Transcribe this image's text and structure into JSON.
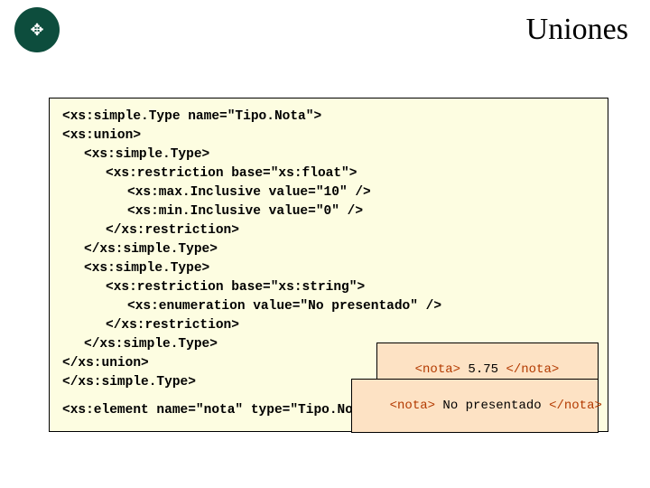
{
  "title": "Uniones",
  "code": {
    "l1": "<xs:simple.Type name=\"Tipo.Nota\">",
    "l2": "<xs:union>",
    "l3": "<xs:simple.Type>",
    "l4": "<xs:restriction base=\"xs:float\">",
    "l5": "<xs:max.Inclusive value=\"10\" />",
    "l6": "<xs:min.Inclusive value=\"0\" />",
    "l7": "</xs:restriction>",
    "l8": "</xs:simple.Type>",
    "l9": "<xs:simple.Type>",
    "l10": "<xs:restriction base=\"xs:string\">",
    "l11": "<xs:enumeration value=\"No presentado\" />",
    "l12": "</xs:restriction>",
    "l13": "</xs:simple.Type>",
    "l14": "</xs:union>",
    "l15": "</xs:simple.Type>",
    "l16": "<xs:element name=\"nota\" type=\"Tipo.Nota\" />"
  },
  "ex1": {
    "open": "<nota>",
    "val": " 5.75 ",
    "close": "</nota>"
  },
  "ex2": {
    "open": "<nota>",
    "val": " No presentado ",
    "close": "</nota>"
  }
}
